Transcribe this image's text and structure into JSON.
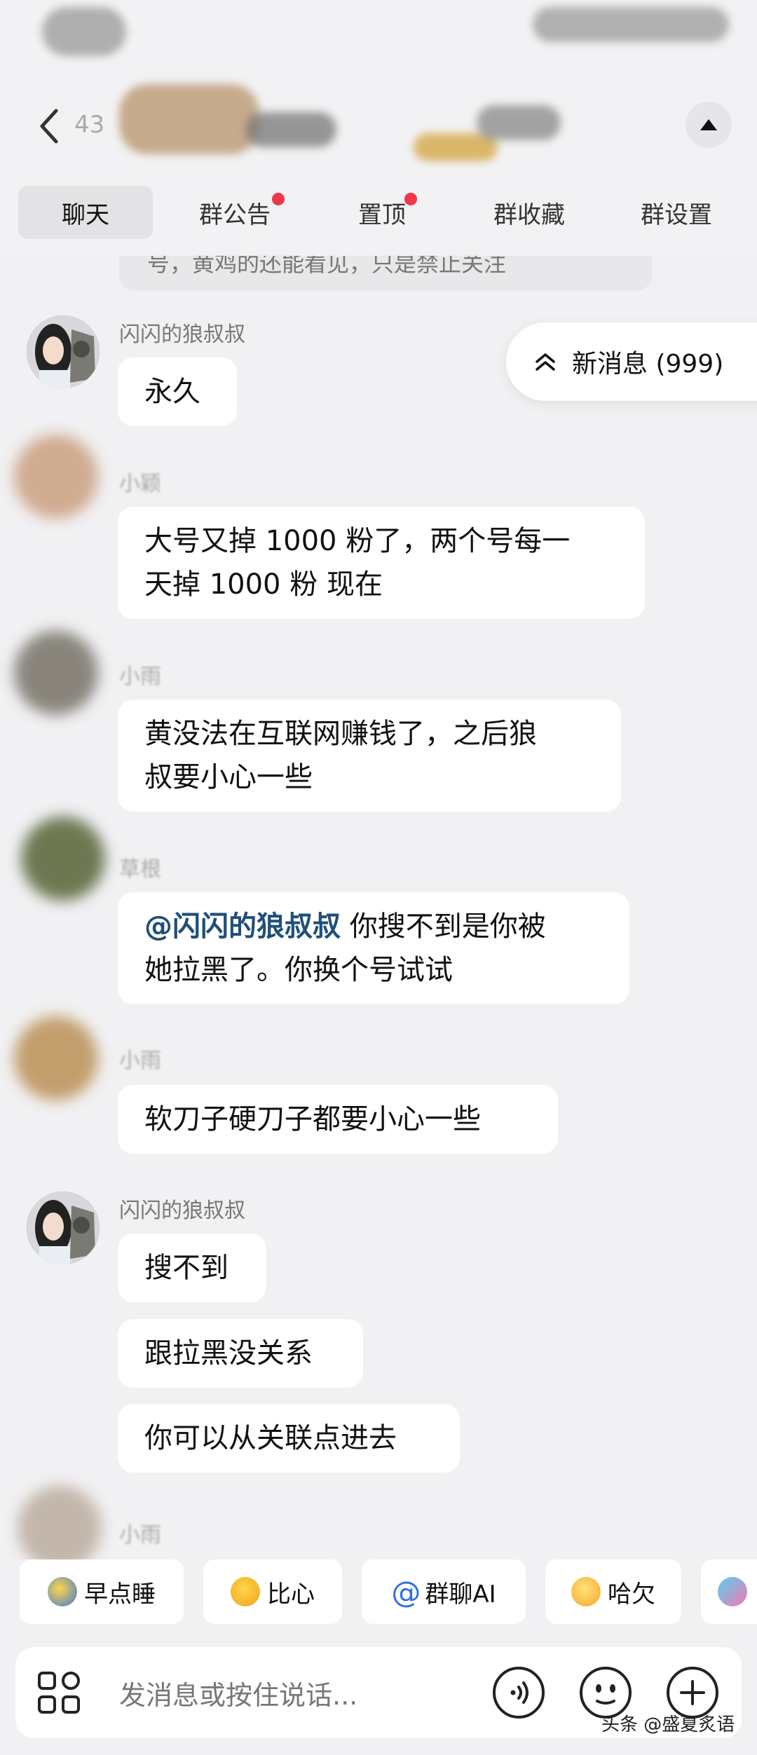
{
  "header": {
    "back_count": "43",
    "tabs": [
      {
        "label": "聊天",
        "active": true,
        "dot": false
      },
      {
        "label": "群公告",
        "active": false,
        "dot": true
      },
      {
        "label": "置顶",
        "active": false,
        "dot": true
      },
      {
        "label": "群收藏",
        "active": false,
        "dot": false
      },
      {
        "label": "群设置",
        "active": false,
        "dot": false
      }
    ]
  },
  "chat": {
    "previous_bubble_text": "号，黄鸡的还能看见，只是禁止关注",
    "new_messages": "新消息 (999)",
    "messages": [
      {
        "sender": "闪闪的狼叔叔",
        "text": "永久"
      },
      {
        "sender": "小颖",
        "text_lines": [
          "大号又掉 1000 粉了，两个号每一",
          "天掉 1000 粉 现在"
        ]
      },
      {
        "sender": "小雨",
        "text_lines": [
          "黄没法在互联网赚钱了，之后狼",
          "叔要小心一些"
        ]
      },
      {
        "sender": "草根",
        "mention": "@闪闪的狼叔叔",
        "text_after_mention": " 你搜不到是你被",
        "text_line2": "她拉黑了。你换个号试试"
      },
      {
        "sender": "小雨",
        "text": "软刀子硬刀子都要小心一些"
      },
      {
        "sender": "闪闪的狼叔叔",
        "texts": [
          "搜不到",
          "跟拉黑没关系",
          "你可以从关联点进去"
        ]
      },
      {
        "sender": "小雨"
      }
    ]
  },
  "quick_replies": [
    {
      "label": "早点睡",
      "icon": "moon-sleep-icon"
    },
    {
      "label": "比心",
      "icon": "heart-hands-icon"
    },
    {
      "label": "群聊AI",
      "icon": "at-icon"
    },
    {
      "label": "哈欠",
      "icon": "yawn-icon"
    }
  ],
  "input": {
    "placeholder": "发消息或按住说话..."
  },
  "watermark": "头条 @盛夏炙语"
}
